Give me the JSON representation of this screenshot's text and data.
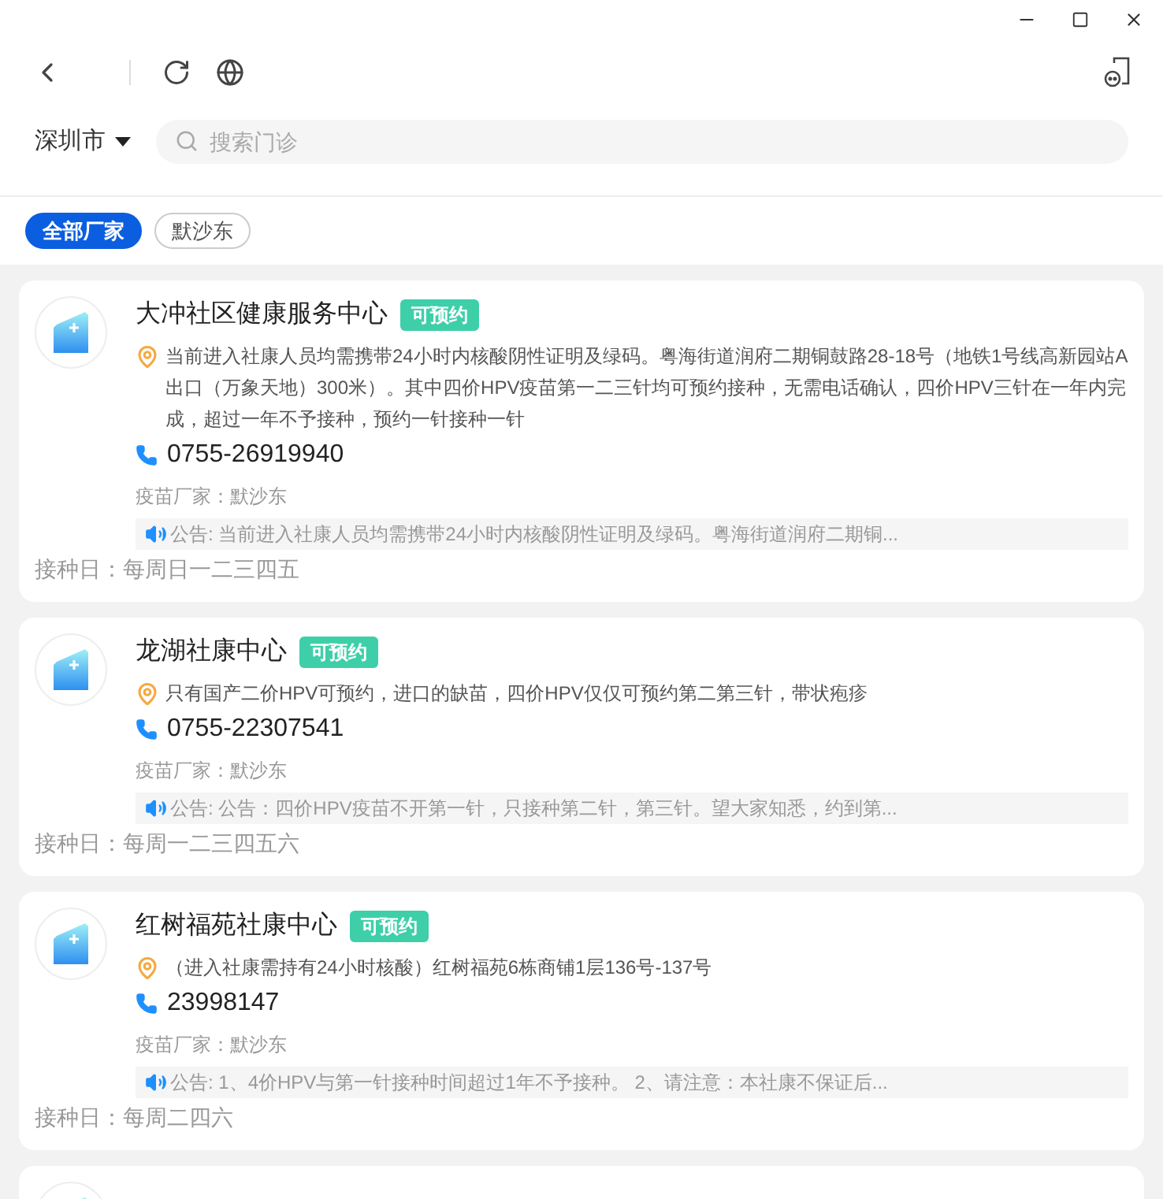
{
  "city": {
    "label": "深圳市"
  },
  "search": {
    "placeholder": "搜索门诊"
  },
  "filters": [
    {
      "label": "全部厂家",
      "selected": true
    },
    {
      "label": "默沙东",
      "selected": false
    }
  ],
  "clinics": [
    {
      "name": "大冲社区健康服务中心",
      "badge": "可预约",
      "address": "当前进入社康人员均需携带24小时内核酸阴性证明及绿码。粤海街道润府二期铜鼓路28-18号（地铁1号线高新园站A出口（万象天地）300米）。其中四价HPV疫苗第一二三针均可预约接种，无需电话确认，四价HPV三针在一年内完成，超过一年不予接种，预约一针接种一针",
      "phone": "0755-26919940",
      "vendor": "疫苗厂家：默沙东",
      "notice": "公告: 当前进入社康人员均需携带24小时内核酸阴性证明及绿码。粤海街道润府二期铜...",
      "days": "接种日：每周日一二三四五"
    },
    {
      "name": "龙湖社康中心",
      "badge": "可预约",
      "address": "只有国产二价HPV可预约，进口的缺苗，四价HPV仅仅可预约第二第三针，带状疱疹",
      "phone": "0755-22307541",
      "vendor": "疫苗厂家：默沙东",
      "notice": "公告: 公告：四价HPV疫苗不开第一针，只接种第二针，第三针。望大家知悉，约到第...",
      "days": "接种日：每周一二三四五六"
    },
    {
      "name": "红树福苑社康中心",
      "badge": "可预约",
      "address": "（进入社康需持有24小时核酸）红树福苑6栋商铺1层136号-137号",
      "phone": "23998147",
      "vendor": "疫苗厂家：默沙东",
      "notice": "公告: 1、4价HPV与第一针接种时间超过1年不予接种。 2、请注意：本社康不保证后...",
      "days": "接种日：每周二四六"
    }
  ]
}
